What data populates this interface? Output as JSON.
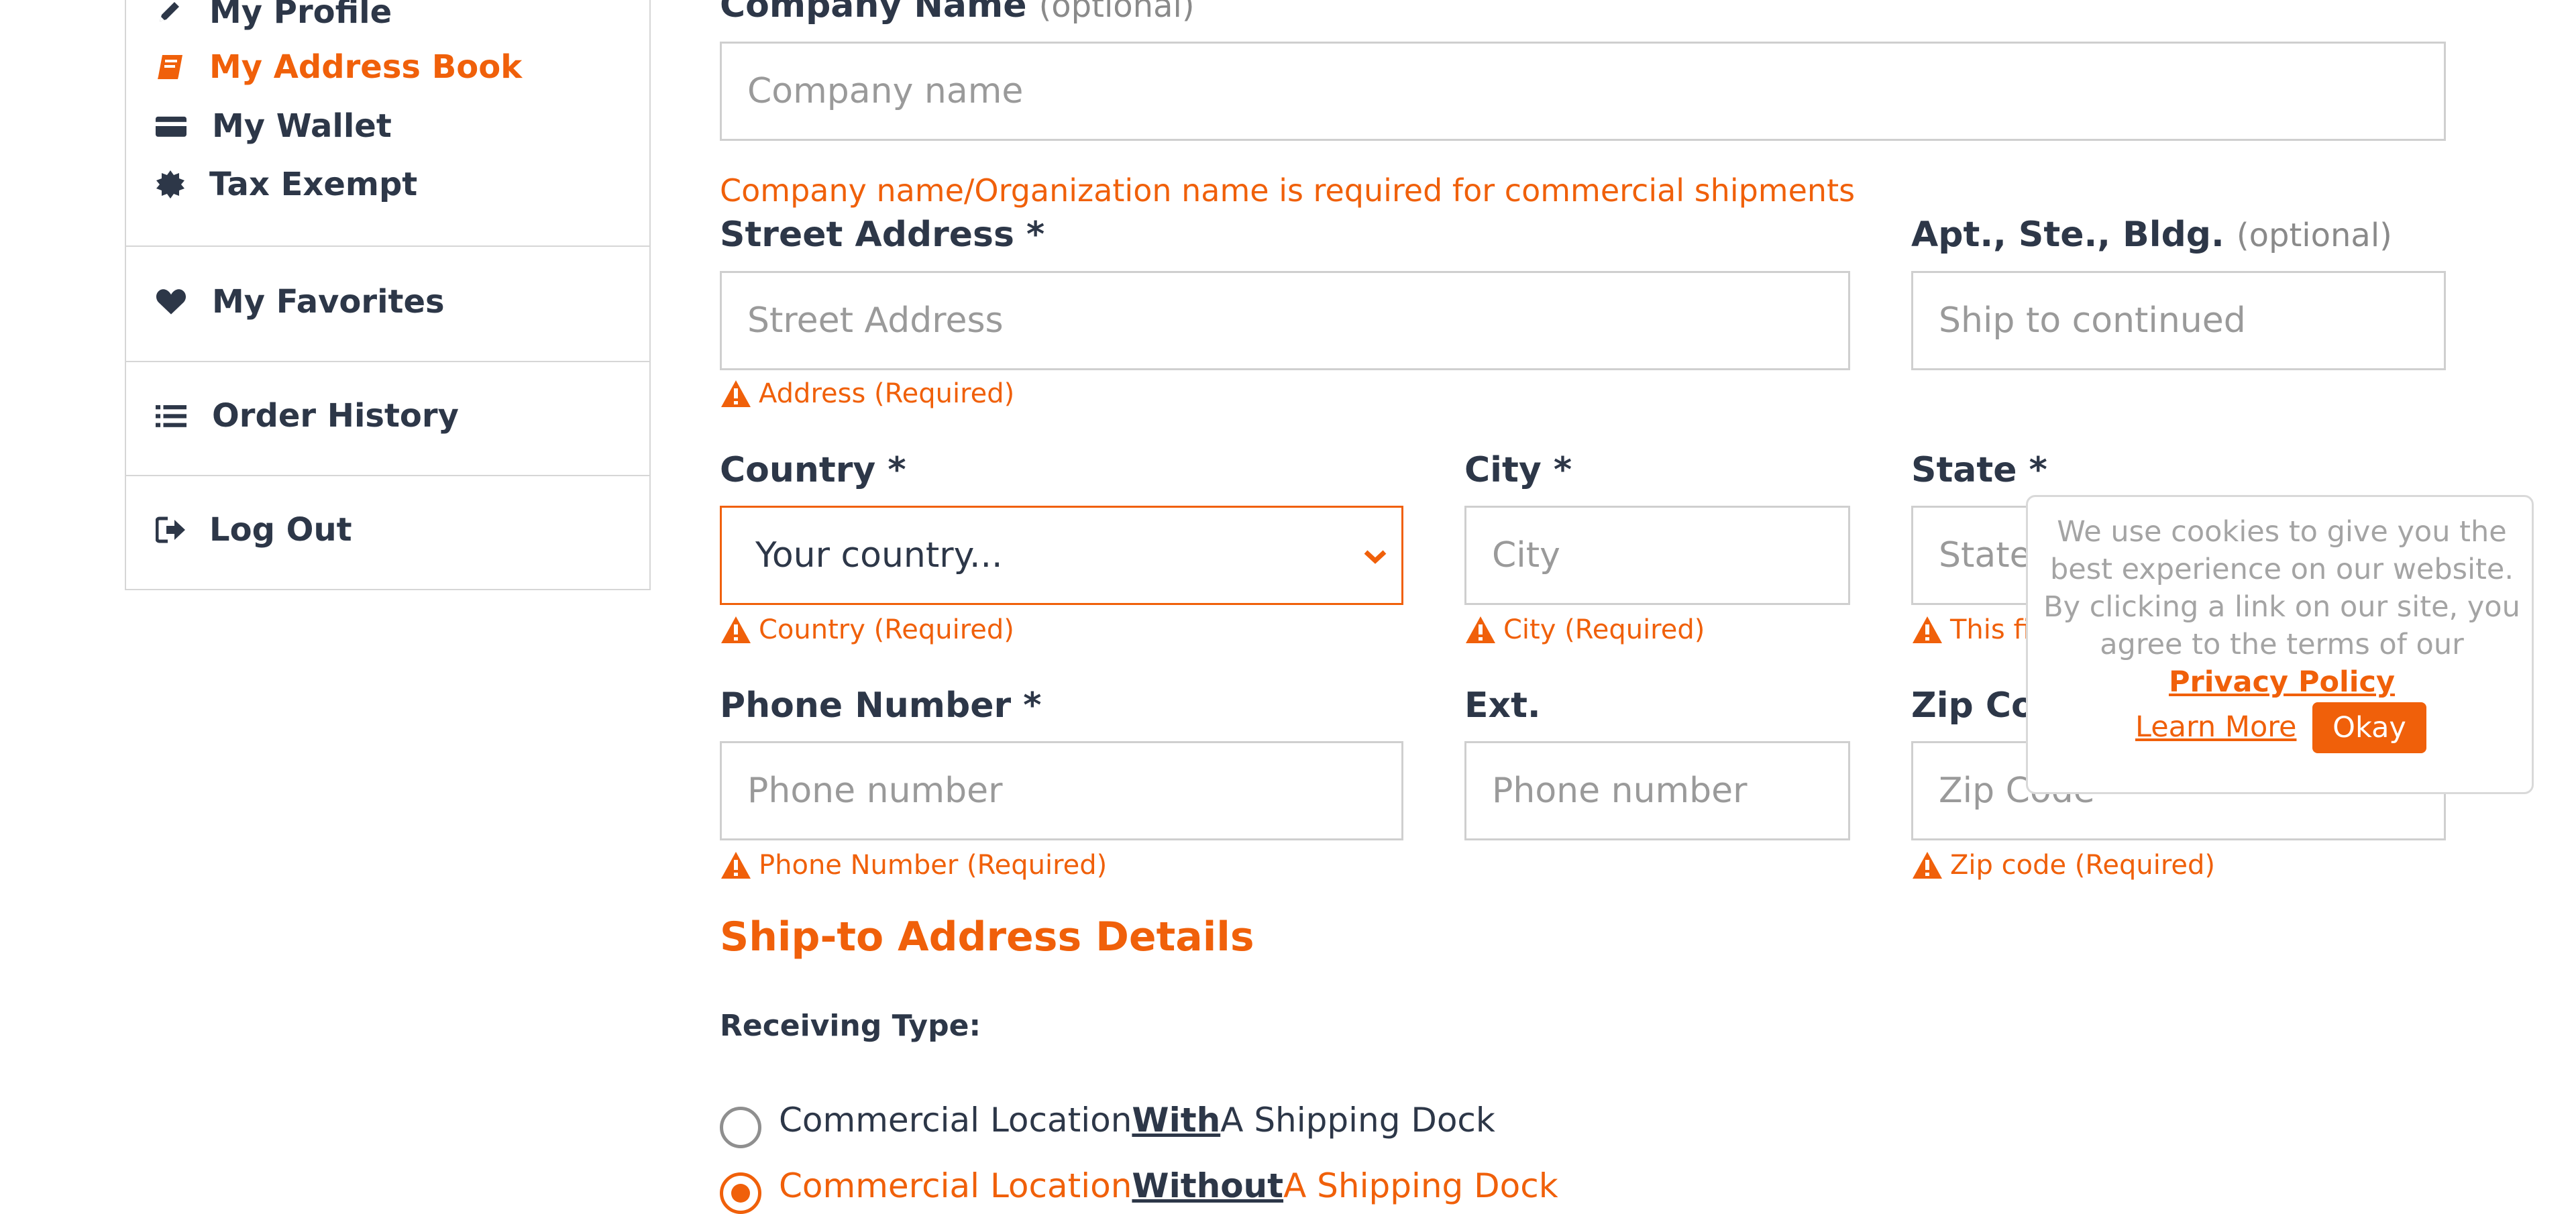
{
  "sidebar": {
    "items": [
      {
        "label": "My Profile",
        "icon": "pencil-icon"
      },
      {
        "label": "My Address Book",
        "icon": "book-icon",
        "active": true
      },
      {
        "label": "My Wallet",
        "icon": "credit-card-icon"
      },
      {
        "label": "Tax Exempt",
        "icon": "certificate-icon"
      }
    ],
    "favorites": {
      "label": "My Favorites",
      "icon": "heart-icon"
    },
    "order_history": {
      "label": "Order History",
      "icon": "list-icon"
    },
    "logout": {
      "label": "Log Out",
      "icon": "sign-out-icon"
    }
  },
  "form": {
    "company": {
      "label": "Company Name",
      "optional": "(optional)",
      "placeholder": "Company name"
    },
    "company_notice": "Company name/Organization name is required for commercial shipments",
    "street": {
      "label": "Street Address *",
      "placeholder": "Street Address",
      "error": "Address (Required)"
    },
    "apt": {
      "label": "Apt., Ste., Bldg.",
      "optional": "(optional)",
      "placeholder": "Ship to continued"
    },
    "country": {
      "label": "Country *",
      "value": "Your country...",
      "error": "Country (Required)"
    },
    "city": {
      "label": "City *",
      "placeholder": "City",
      "error": "City (Required)"
    },
    "state": {
      "label": "State *",
      "placeholder": "State",
      "error": "This fi"
    },
    "phone": {
      "label": "Phone Number *",
      "placeholder": "Phone number",
      "error": "Phone Number (Required)"
    },
    "ext": {
      "label": "Ext.",
      "placeholder": "Phone number"
    },
    "zip": {
      "label": "Zip Co",
      "placeholder": "Zip Code",
      "error": "Zip code (Required)"
    }
  },
  "ship_to": {
    "title": "Ship-to Address Details",
    "receiving_label": "Receiving Type:",
    "options": [
      {
        "pre": "Commercial Location ",
        "em": "With",
        "post": " A Shipping Dock",
        "selected": false
      },
      {
        "pre": "Commercial Location ",
        "em": "Without",
        "post": " A Shipping Dock",
        "selected": true
      }
    ]
  },
  "cookie": {
    "text": "We use cookies to give you the best experience on our website. By clicking a link on our site, you agree to the terms of our",
    "link": "Privacy Policy",
    "learn_more": "Learn More",
    "okay": "Okay"
  },
  "colors": {
    "accent": "#f0600a",
    "text": "#2d3748",
    "border": "#cfcfcf"
  }
}
